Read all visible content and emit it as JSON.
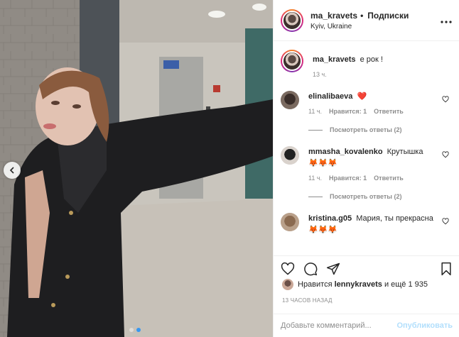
{
  "post": {
    "username": "ma_kravets",
    "separator": "•",
    "follow_label": "Подписки",
    "location": "Kyiv, Ukraine",
    "more_icon": "more-horizontal-icon"
  },
  "caption": {
    "username": "ma_kravets",
    "text": "е рок !",
    "time": "13 ч."
  },
  "comments": [
    {
      "username": "elinalibaeva",
      "text": "",
      "emoji": "❤️",
      "time": "11 ч.",
      "likes": "Нравится: 1",
      "reply_label": "Ответить",
      "view_replies": "Посмотреть ответы (2)"
    },
    {
      "username": "mmasha_kovalenko",
      "text": "Крутышка",
      "emoji": "🦊🦊🦊",
      "time": "11 ч.",
      "likes": "Нравится: 1",
      "reply_label": "Ответить",
      "view_replies": "Посмотреть ответы (2)"
    },
    {
      "username": "kristina.g05",
      "text": "Мария, ты прекрасна",
      "emoji": "🦊🦊🦊",
      "time": "",
      "likes": "",
      "reply_label": "",
      "view_replies": ""
    }
  ],
  "actions": {
    "like_icon": "heart-icon",
    "comment_icon": "comment-icon",
    "share_icon": "share-icon",
    "save_icon": "bookmark-icon"
  },
  "likes": {
    "prefix": "Нравится",
    "user": "lennykravets",
    "suffix": "и ещё 1 935"
  },
  "timestamp": "13 ЧАСОВ НАЗАД",
  "comment_box": {
    "placeholder": "Добавьте комментарий...",
    "post_label": "Опубликовать"
  },
  "colors": {
    "accent": "#3897f0",
    "post_disabled": "#b2dffc",
    "heart": "#ed4956"
  }
}
